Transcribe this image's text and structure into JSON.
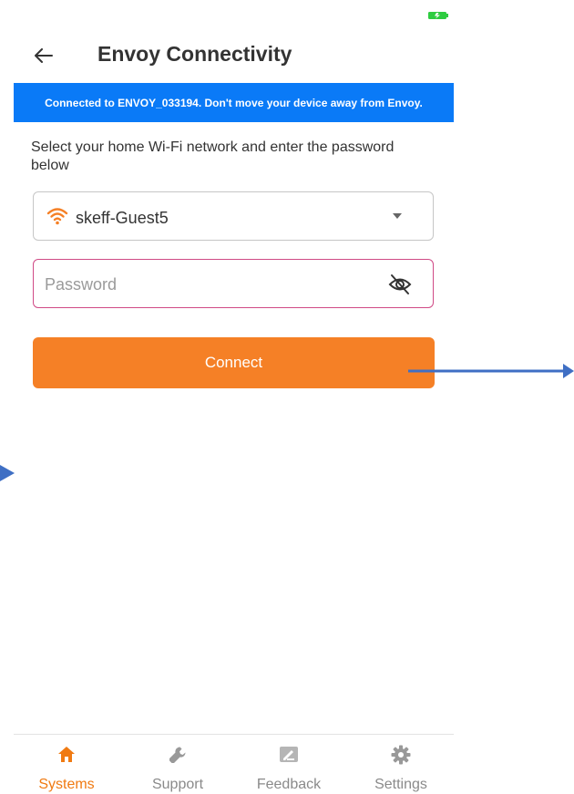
{
  "header": {
    "title": "Envoy Connectivity"
  },
  "banner": {
    "text": "Connected to ENVOY_033194. Don't move your device away from Envoy."
  },
  "form": {
    "instruction": "Select your home Wi-Fi network and enter the password below",
    "network": {
      "selected": "skeff-Guest5",
      "icon": "wifi-icon"
    },
    "password": {
      "placeholder": "Password",
      "value": "",
      "visibility_icon": "eye-hidden-icon"
    },
    "connect_label": "Connect"
  },
  "tabbar": {
    "tabs": [
      {
        "label": "Systems",
        "icon": "home-icon",
        "active": true
      },
      {
        "label": "Support",
        "icon": "wrench-icon",
        "active": false
      },
      {
        "label": "Feedback",
        "icon": "feedback-icon",
        "active": false
      },
      {
        "label": "Settings",
        "icon": "gear-icon",
        "active": false
      }
    ]
  },
  "colors": {
    "banner": "#0a7af7",
    "accent": "#f58026",
    "active_tab": "#f07a12",
    "password_border": "#d04a86",
    "annotation": "#3f6fc4"
  }
}
